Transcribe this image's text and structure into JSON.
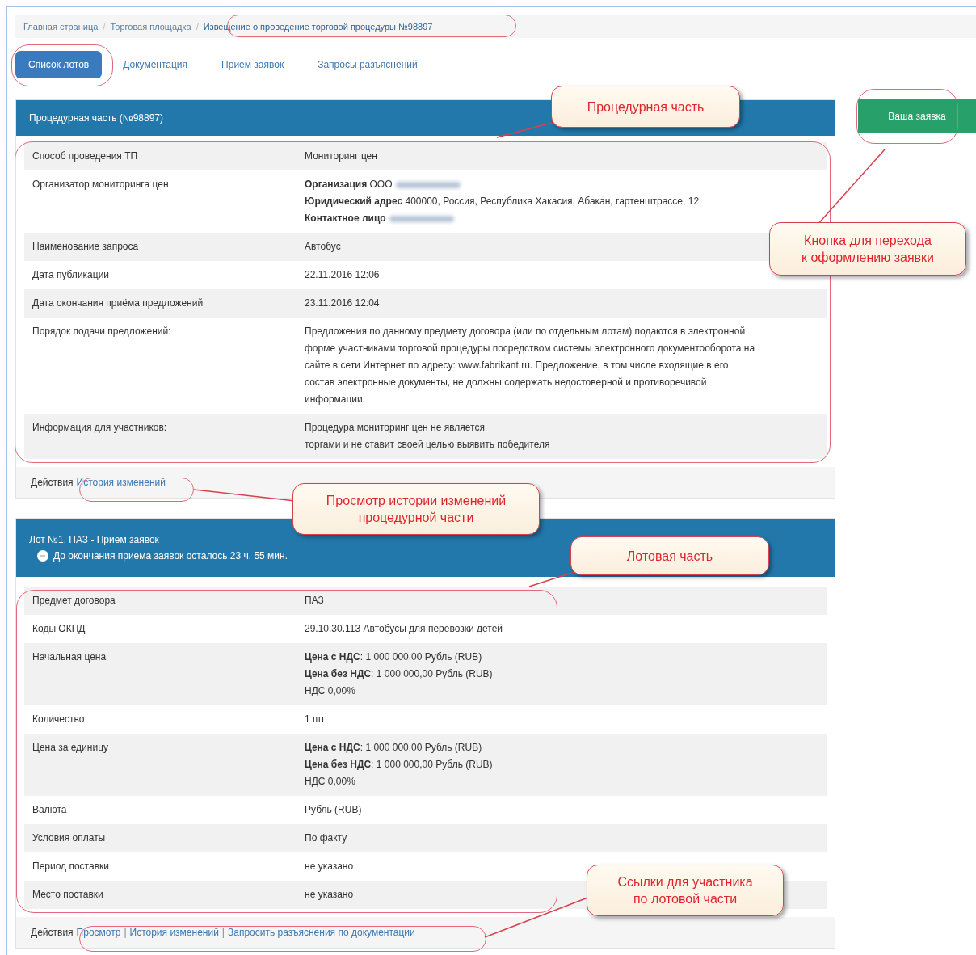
{
  "breadcrumbs": {
    "separator": "/",
    "items": [
      {
        "label": "Главная страница",
        "current": false
      },
      {
        "label": "Торговая площадка",
        "current": false
      },
      {
        "label": "Извещение о проведение торговой процедуры №98897",
        "current": true
      }
    ]
  },
  "tabs": [
    {
      "label": "Список лотов",
      "selected": true
    },
    {
      "label": "Документация",
      "selected": false
    },
    {
      "label": "Прием заявок",
      "selected": false
    },
    {
      "label": "Запросы разъяснений",
      "selected": false
    }
  ],
  "procedure": {
    "title": "Процедурная часть (№98897)",
    "rows": [
      {
        "label": "Способ проведения ТП",
        "lines": [
          {
            "text": "Мониторинг цен",
            "redacted": false
          }
        ]
      },
      {
        "label": "Организатор мониторинга цен",
        "lines": [
          {
            "text": "**Организация** ООО",
            "redacted": true
          },
          {
            "text": "**Юридический адрес** 400000, Россия, Республика Хакасия, Абакан, гартенштрассе, 12",
            "redacted": false
          },
          {
            "text": "**Контактное лицо**",
            "redacted": true
          }
        ]
      },
      {
        "label": "Наименование запроса",
        "lines": [
          {
            "text": "Автобус",
            "redacted": false
          }
        ]
      },
      {
        "label": "Дата публикации",
        "lines": [
          {
            "text": "22.11.2016 12:06",
            "redacted": false
          }
        ]
      },
      {
        "label": "Дата окончания приёма предложений",
        "lines": [
          {
            "text": "23.11.2016 12:04",
            "redacted": false
          }
        ]
      },
      {
        "label": "Порядок подачи предложений:",
        "lines": [
          {
            "text": "Предложения по данному предмету договора (или по отдельным лотам) подаются в электронной форме участниками торговой процедуры посредством системы электронного документооборота на сайте в сети Интернет по адресу: www.fabrikant.ru. Предложение, в том числе входящие в его состав электронные документы, не должны содержать недостоверной и противоречивой информации.",
            "redacted": false
          }
        ]
      },
      {
        "label": "Информация для участников:",
        "lines": [
          {
            "text": "Процедура мониторинг цен не является",
            "redacted": false
          },
          {
            "text": "торгами и не ставит своей целью выявить победителя",
            "redacted": false
          }
        ]
      }
    ],
    "actions_label": "Действия",
    "links": [
      "История изменений"
    ]
  },
  "apply_button": "Ваша заявка",
  "lot": {
    "title": "Лот №1. ПАЗ - Прием заявок",
    "countdown": "До окончания приема заявок осталось 23 ч. 55 мин.",
    "rows": [
      {
        "label": "Предмет договора",
        "lines": [
          {
            "text": "ПАЗ",
            "redacted": false
          }
        ]
      },
      {
        "label": "Коды ОКПД",
        "lines": [
          {
            "text": "29.10.30.113 Автобусы для перевозки детей",
            "redacted": false
          }
        ]
      },
      {
        "label": "Начальная цена",
        "lines": [
          {
            "text": "**Цена с НДС**: 1 000 000,00 Рубль (RUB)",
            "redacted": false
          },
          {
            "text": "**Цена без НДС**: 1 000 000,00 Рубль (RUB)",
            "redacted": false
          },
          {
            "text": "НДС 0,00%",
            "redacted": false
          }
        ]
      },
      {
        "label": "Количество",
        "lines": [
          {
            "text": "1 шт",
            "redacted": false
          }
        ]
      },
      {
        "label": "Цена за единицу",
        "lines": [
          {
            "text": "**Цена с НДС**: 1 000 000,00 Рубль (RUB)",
            "redacted": false
          },
          {
            "text": "**Цена без НДС**: 1 000 000,00 Рубль (RUB)",
            "redacted": false
          },
          {
            "text": "НДС 0,00%",
            "redacted": false
          }
        ]
      },
      {
        "label": "Валюта",
        "lines": [
          {
            "text": "Рубль (RUB)",
            "redacted": false
          }
        ]
      },
      {
        "label": "Условия оплаты",
        "lines": [
          {
            "text": "По факту",
            "redacted": false
          }
        ]
      },
      {
        "label": "Период поставки",
        "lines": [
          {
            "text": "не указано",
            "redacted": false
          }
        ]
      },
      {
        "label": "Место поставки",
        "lines": [
          {
            "text": "не указано",
            "redacted": false
          }
        ]
      }
    ],
    "actions_label": "Действия",
    "links": [
      "Просмотр",
      "История изменений",
      "Запросить разъяснения по документации"
    ],
    "link_separator": "|"
  },
  "callouts": [
    {
      "lines": [
        "Процедурная часть"
      ]
    },
    {
      "lines": [
        "Кнопка для перехода",
        "к оформлению заявки"
      ]
    },
    {
      "lines": [
        "Просмотр истории изменений",
        "процедурной части"
      ]
    },
    {
      "lines": [
        "Лотовая часть"
      ]
    },
    {
      "lines": [
        "Ссылки для участника",
        "по лотовой части"
      ]
    }
  ]
}
